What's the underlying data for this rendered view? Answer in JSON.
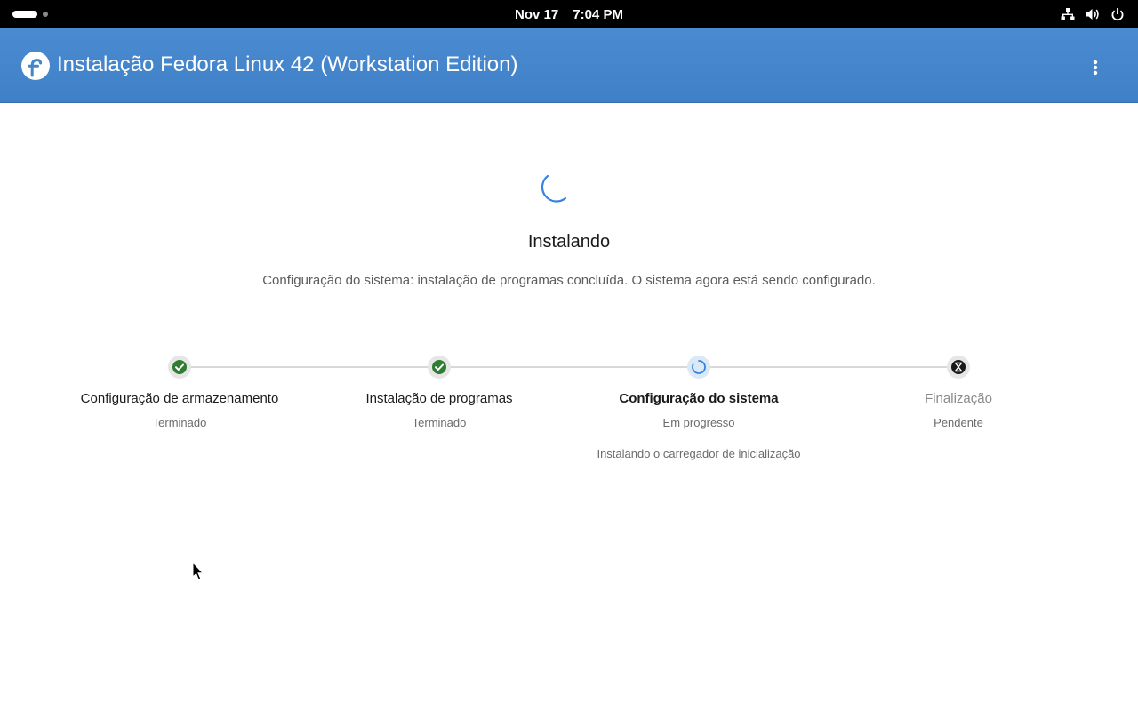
{
  "topbar": {
    "date": "Nov 17",
    "time": "7:04 PM",
    "tray_icons": [
      "network-icon",
      "volume-icon",
      "power-icon"
    ]
  },
  "app": {
    "title": "Instalação Fedora Linux 42 (Workstation Edition)",
    "logo_icon": "fedora-logo-icon",
    "menu_icon": "vertical-ellipsis-icon"
  },
  "colors": {
    "header_blue": "#4285c9",
    "success_green": "#2e7d32",
    "progress_blue": "#3584e4"
  },
  "progress": {
    "heading": "Instalando",
    "subtitle": "Configuração do sistema: instalação de programas concluída. O sistema agora está sendo configurado."
  },
  "steps": [
    {
      "label": "Configuração de armazenamento",
      "status": "Terminado",
      "state": "done",
      "icon": "check-icon"
    },
    {
      "label": "Instalação de programas",
      "status": "Terminado",
      "state": "done",
      "icon": "check-icon"
    },
    {
      "label": "Configuração do sistema",
      "status": "Em progresso",
      "state": "in-progress",
      "icon": "spinner-icon",
      "detail": "Instalando o carregador de inicialização"
    },
    {
      "label": "Finalização",
      "status": "Pendente",
      "state": "pending",
      "icon": "hourglass-icon"
    }
  ]
}
